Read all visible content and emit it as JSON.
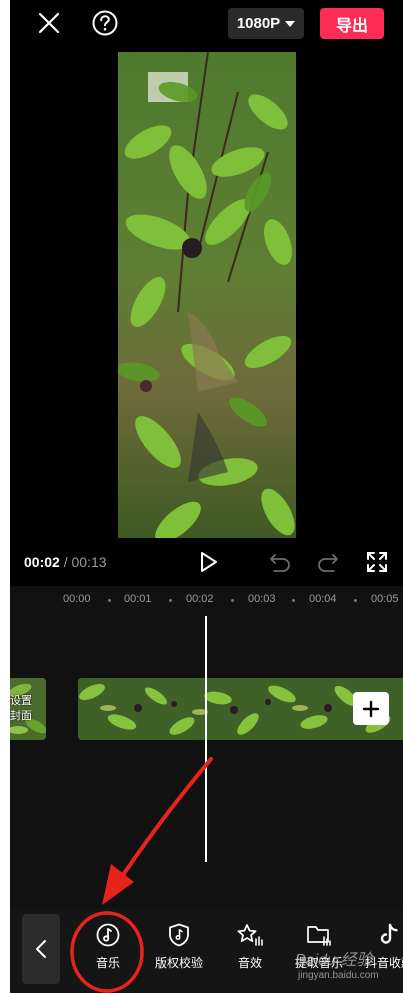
{
  "header": {
    "resolution": "1080P",
    "export_label": "导出"
  },
  "playback": {
    "current_time": "00:02",
    "separator": " / ",
    "total_time": "00:13"
  },
  "timeline": {
    "ticks": [
      "00:00",
      "00:01",
      "00:02",
      "00:03",
      "00:04",
      "00:05"
    ],
    "cover_label": "设置\n封面"
  },
  "toolbar": {
    "items": [
      {
        "label": "音乐",
        "icon": "music-note-icon"
      },
      {
        "label": "版权校验",
        "icon": "copyright-shield-icon"
      },
      {
        "label": "音效",
        "icon": "sound-effect-star-icon"
      },
      {
        "label": "提取音乐",
        "icon": "folder-icon"
      },
      {
        "label": "抖音收藏",
        "icon": "tiktok-icon"
      }
    ]
  },
  "watermark": {
    "text": "Baidu 经验",
    "url": "jingyan.baidu.com"
  },
  "colors": {
    "export": "#fe2c55",
    "annotation": "#e8231c",
    "background": "#000000"
  }
}
